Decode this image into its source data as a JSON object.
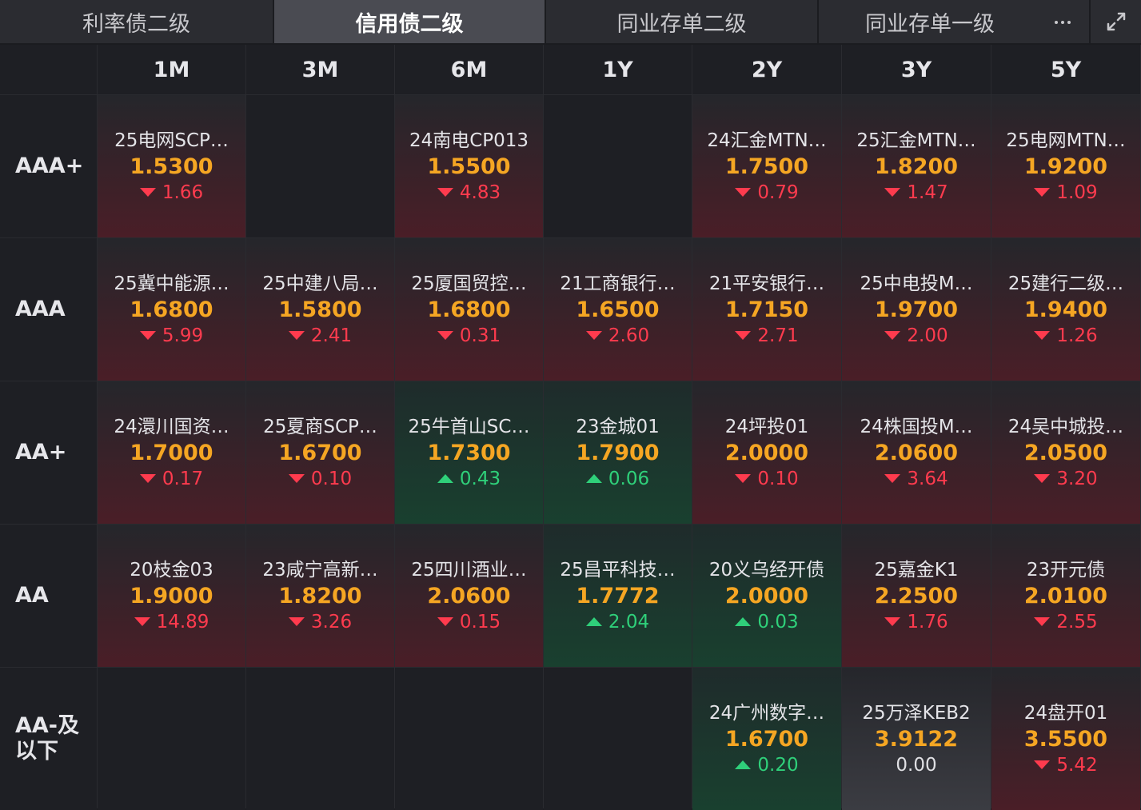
{
  "tabs": [
    {
      "label": "利率债二级",
      "active": false
    },
    {
      "label": "信用债二级",
      "active": true
    },
    {
      "label": "同业存单二级",
      "active": false
    },
    {
      "label": "同业存单一级",
      "active": false
    }
  ],
  "toolbar": {
    "more_icon": "more-horizontal-icon",
    "expand_icon": "expand-icon"
  },
  "colors": {
    "yield": "#f5a623",
    "up": "#ff3b4e",
    "down": "#2fd07a",
    "active_tab": "#4a4b52"
  },
  "grid": {
    "columns": [
      "1M",
      "3M",
      "6M",
      "1Y",
      "2Y",
      "3Y",
      "5Y"
    ],
    "rows": [
      {
        "rating": "AAA+",
        "cells": [
          {
            "name": "25电网SCP…",
            "yield": "1.5300",
            "change": "1.66",
            "dir": "up"
          },
          null,
          {
            "name": "24南电CP013",
            "yield": "1.5500",
            "change": "4.83",
            "dir": "up"
          },
          null,
          {
            "name": "24汇金MTN…",
            "yield": "1.7500",
            "change": "0.79",
            "dir": "up"
          },
          {
            "name": "25汇金MTN…",
            "yield": "1.8200",
            "change": "1.47",
            "dir": "up"
          },
          {
            "name": "25电网MTN…",
            "yield": "1.9200",
            "change": "1.09",
            "dir": "up"
          }
        ]
      },
      {
        "rating": "AAA",
        "cells": [
          {
            "name": "25冀中能源…",
            "yield": "1.6800",
            "change": "5.99",
            "dir": "up"
          },
          {
            "name": "25中建八局…",
            "yield": "1.5800",
            "change": "2.41",
            "dir": "up"
          },
          {
            "name": "25厦国贸控…",
            "yield": "1.6800",
            "change": "0.31",
            "dir": "up"
          },
          {
            "name": "21工商银行…",
            "yield": "1.6500",
            "change": "2.60",
            "dir": "up"
          },
          {
            "name": "21平安银行…",
            "yield": "1.7150",
            "change": "2.71",
            "dir": "up"
          },
          {
            "name": "25中电投M…",
            "yield": "1.9700",
            "change": "2.00",
            "dir": "up"
          },
          {
            "name": "25建行二级…",
            "yield": "1.9400",
            "change": "1.26",
            "dir": "up"
          }
        ]
      },
      {
        "rating": "AA+",
        "cells": [
          {
            "name": "24澴川国资…",
            "yield": "1.7000",
            "change": "0.17",
            "dir": "up"
          },
          {
            "name": "25夏商SCP…",
            "yield": "1.6700",
            "change": "0.10",
            "dir": "up"
          },
          {
            "name": "25牛首山SC…",
            "yield": "1.7300",
            "change": "0.43",
            "dir": "down"
          },
          {
            "name": "23金城01",
            "yield": "1.7900",
            "change": "0.06",
            "dir": "down"
          },
          {
            "name": "24坪投01",
            "yield": "2.0000",
            "change": "0.10",
            "dir": "up"
          },
          {
            "name": "24株国投M…",
            "yield": "2.0600",
            "change": "3.64",
            "dir": "up"
          },
          {
            "name": "24吴中城投…",
            "yield": "2.0500",
            "change": "3.20",
            "dir": "up"
          }
        ]
      },
      {
        "rating": "AA",
        "cells": [
          {
            "name": "20枝金03",
            "yield": "1.9000",
            "change": "14.89",
            "dir": "up"
          },
          {
            "name": "23咸宁高新…",
            "yield": "1.8200",
            "change": "3.26",
            "dir": "up"
          },
          {
            "name": "25四川酒业…",
            "yield": "2.0600",
            "change": "0.15",
            "dir": "up"
          },
          {
            "name": "25昌平科技…",
            "yield": "1.7772",
            "change": "2.04",
            "dir": "down"
          },
          {
            "name": "20义乌经开债",
            "yield": "2.0000",
            "change": "0.03",
            "dir": "down"
          },
          {
            "name": "25嘉金K1",
            "yield": "2.2500",
            "change": "1.76",
            "dir": "up"
          },
          {
            "name": "23开元债",
            "yield": "2.0100",
            "change": "2.55",
            "dir": "up"
          }
        ]
      },
      {
        "rating": "AA-及\n以下",
        "cells": [
          null,
          null,
          null,
          null,
          {
            "name": "24广州数字…",
            "yield": "1.6700",
            "change": "0.20",
            "dir": "down"
          },
          {
            "name": "25万泽KEB2",
            "yield": "3.9122",
            "change": "0.00",
            "dir": "flat"
          },
          {
            "name": "24盘开01",
            "yield": "3.5500",
            "change": "5.42",
            "dir": "up"
          }
        ]
      }
    ]
  }
}
